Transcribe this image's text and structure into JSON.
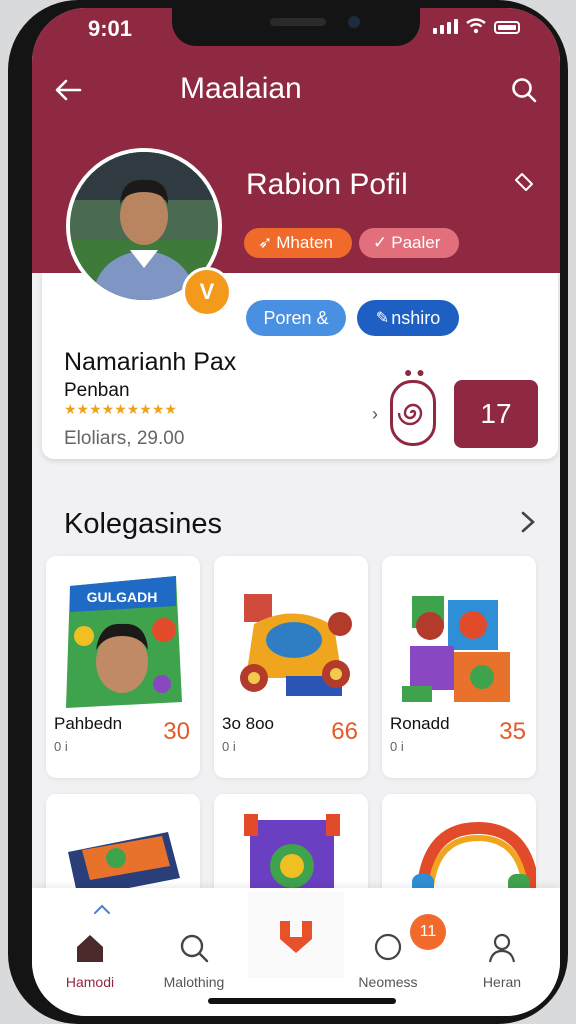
{
  "status": {
    "time": "9:01"
  },
  "header": {
    "title": "Maalaian"
  },
  "profile": {
    "title": "Rabion Pofil",
    "chips": [
      "Mhaten",
      "Paaler"
    ],
    "pills": [
      "Poren &",
      "nshiro"
    ],
    "badge_letter": "V",
    "name": "Namarianh Pax",
    "role": "Penban",
    "stars": "★★★★★★★★★",
    "followers": "Eloliars, 29.00",
    "count": "17"
  },
  "section": {
    "title": "Kolegasines"
  },
  "products": [
    {
      "name": "Pahbedn",
      "sub": "0 i",
      "price": "30",
      "art": "GULGADH"
    },
    {
      "name": "3o 8oo",
      "sub": "0 i",
      "price": "66"
    },
    {
      "name": "Ronadd",
      "sub": "0 i",
      "price": "35"
    }
  ],
  "tabs": [
    {
      "label": "Hamodi",
      "icon": "home-icon"
    },
    {
      "label": "Malothing",
      "icon": "search-icon"
    },
    {
      "label": "Neomess",
      "icon": "chat-icon"
    },
    {
      "label": "Heran",
      "icon": "person-icon"
    }
  ],
  "notification": {
    "count": "11"
  },
  "colors": {
    "brand": "#8e2941",
    "accent": "#f06a2b",
    "blue": "#1e5fc4"
  }
}
